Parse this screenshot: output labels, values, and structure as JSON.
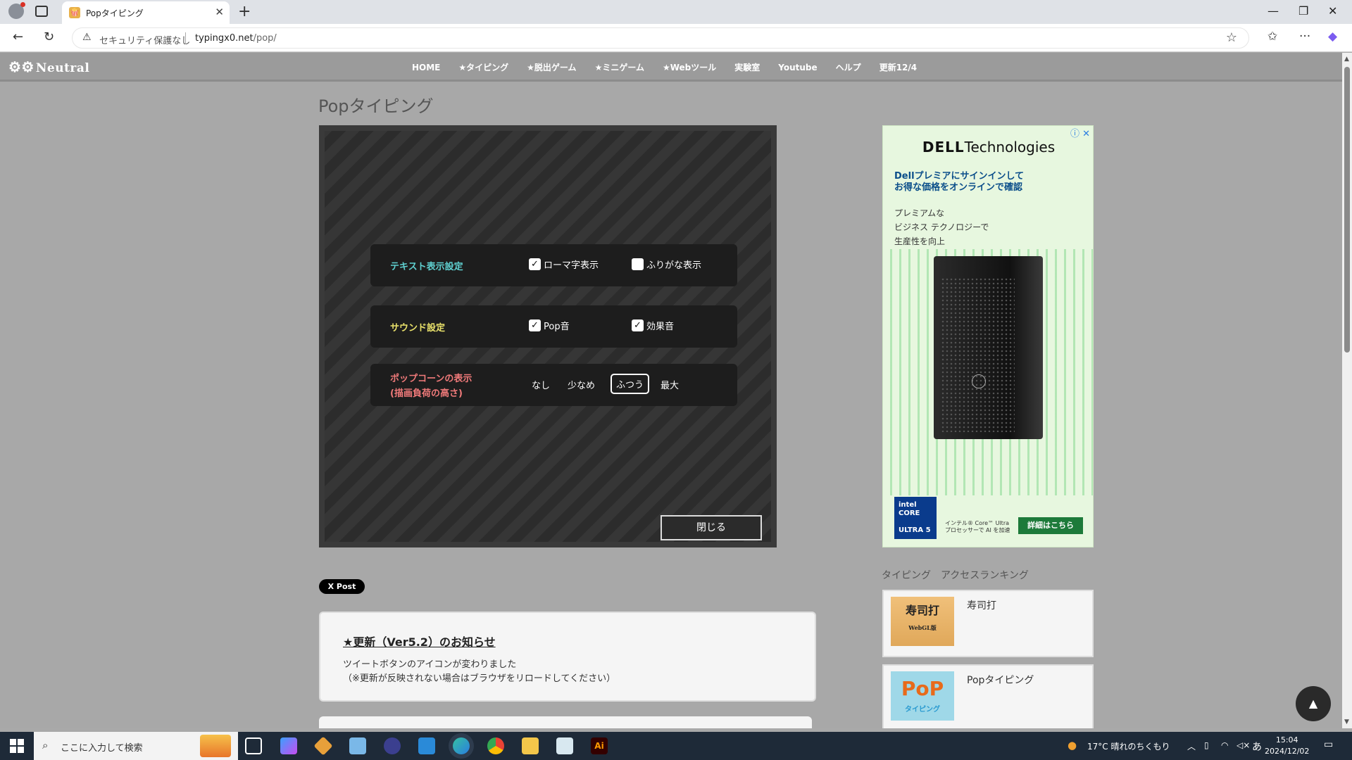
{
  "browser": {
    "tab_title": "Popタイピング",
    "tab_favicon": "🍿",
    "security_label": "セキュリティ保護なし",
    "url_host": "typingx0.net",
    "url_path": "/pop/"
  },
  "site": {
    "logo": "Neutral",
    "menu": [
      "HOME",
      "★タイピング",
      "★脱出ゲーム",
      "★ミニゲーム",
      "★Webツール",
      "実験室",
      "Youtube",
      "ヘルプ",
      "更新12/4"
    ]
  },
  "page_title": "Popタイピング",
  "settings": {
    "text_display": {
      "label": "テキスト表示設定",
      "label_color": "#5fd0d0",
      "romaji": {
        "label": "ローマ字表示",
        "checked": true
      },
      "furigana": {
        "label": "ふりがな表示",
        "checked": false
      }
    },
    "sound": {
      "label": "サウンド設定",
      "label_color": "#e8e06a",
      "pop": {
        "label": "Pop音",
        "checked": true
      },
      "effect": {
        "label": "効果音",
        "checked": true
      }
    },
    "popcorn": {
      "label_line1": "ポップコーンの表示",
      "label_line2": "(描画負荷の高さ)",
      "label_color": "#f07a7a",
      "options": [
        "なし",
        "少なめ",
        "ふつう",
        "最大"
      ],
      "selected": "ふつう"
    },
    "close_label": "閉じる"
  },
  "post_button": "X Post",
  "news": {
    "heading": "★更新（Ver5.2）のお知らせ",
    "line1": "ツイートボタンのアイコンが変わりました",
    "line2": "（※更新が反映されない場合はブラウザをリロードしてください）"
  },
  "ad": {
    "brand_bold": "DELL",
    "brand_rest": "Technologies",
    "headline1": "Dellプレミアにサインインして",
    "headline2": "お得な価格をオンラインで確認",
    "sub1": "プレミアムな",
    "sub2": "ビジネス テクノロジーで",
    "sub3": "生産性を向上",
    "intel1": "intel",
    "intel2": "CORE",
    "intel3": "ULTRA 5",
    "caption1": "インテル® Core™ Ultra",
    "caption2": "プロセッサーで AI を加速",
    "cta": "詳細はこちら"
  },
  "ranking": {
    "title": "タイピング　アクセスランキング",
    "items": [
      {
        "name": "寿司打",
        "thumb_text": "寿司打",
        "thumb_sub": "WebGL版"
      },
      {
        "name": "Popタイピング",
        "thumb_text": "PoP",
        "thumb_sub": "タイピング"
      }
    ]
  },
  "taskbar": {
    "search_placeholder": "ここに入力して検索",
    "weather": "17°C  晴れのちくもり",
    "ime": "あ",
    "time": "15:04",
    "date": "2024/12/02"
  }
}
